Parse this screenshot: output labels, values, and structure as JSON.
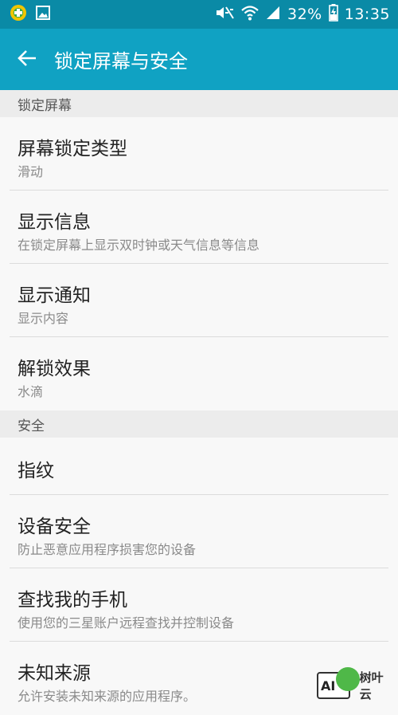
{
  "status_bar": {
    "battery": "32%",
    "time": "13:35",
    "icons": [
      "app-notification-icon",
      "image-notification-icon",
      "mute-icon",
      "wifi-icon",
      "signal-icon",
      "battery-icon"
    ]
  },
  "toolbar": {
    "title": "锁定屏幕与安全"
  },
  "sections": [
    {
      "header": "锁定屏幕",
      "items": [
        {
          "title": "屏幕锁定类型",
          "subtitle": "滑动"
        },
        {
          "title": "显示信息",
          "subtitle": "在锁定屏幕上显示双时钟或天气信息等信息"
        },
        {
          "title": "显示通知",
          "subtitle": "显示内容"
        },
        {
          "title": "解锁效果",
          "subtitle": "水滴"
        }
      ]
    },
    {
      "header": "安全",
      "items": [
        {
          "title": "指纹"
        },
        {
          "title": "设备安全",
          "subtitle": "防止恶意应用程序损害您的设备"
        },
        {
          "title": "查找我的手机",
          "subtitle": "使用您的三星账户远程查找并控制设备"
        },
        {
          "title": "未知来源",
          "subtitle": "允许安装未知来源的应用程序。"
        }
      ]
    }
  ],
  "watermark": {
    "box_text": "AI",
    "text": "树叶云"
  },
  "colors": {
    "status_bar": "#0a8aa6",
    "toolbar": "#10a2c3",
    "section_bg": "#ececec",
    "background": "#f8f8f8"
  }
}
